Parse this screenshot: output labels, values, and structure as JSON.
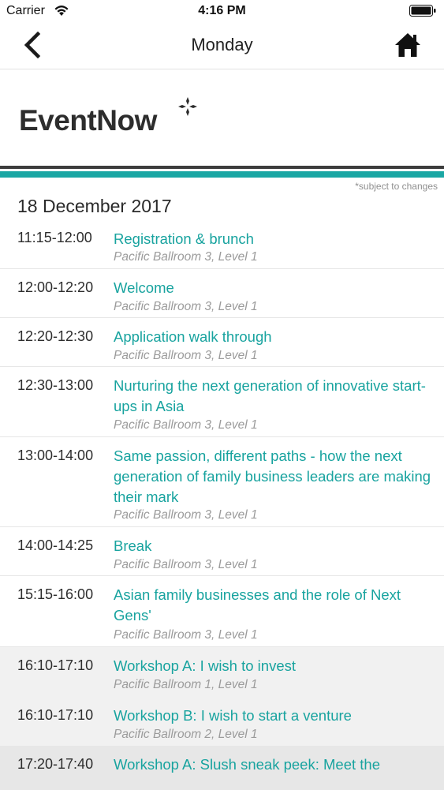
{
  "status": {
    "carrier": "Carrier",
    "time": "4:16 PM"
  },
  "nav": {
    "title": "Monday",
    "back_icon": "chevron-left-icon",
    "home_icon": "home-icon"
  },
  "brand": {
    "logo_text": "EventNow"
  },
  "note": "*subject to changes",
  "date": "18 December 2017",
  "colors": {
    "accent": "#1aa7a4",
    "dark_rule": "#3c3c3c",
    "gray_row": "#f1f1f1"
  },
  "sessions": [
    {
      "time": "11:15-12:00",
      "title": "Registration & brunch",
      "location": "Pacific Ballroom 3, Level 1"
    },
    {
      "time": "12:00-12:20",
      "title": "Welcome",
      "location": "Pacific Ballroom 3, Level 1"
    },
    {
      "time": "12:20-12:30",
      "title": "Application walk through",
      "location": "Pacific Ballroom 3, Level 1"
    },
    {
      "time": "12:30-13:00",
      "title": "Nurturing the next generation of innovative start-ups in Asia",
      "location": "Pacific Ballroom 3, Level 1"
    },
    {
      "time": "13:00-14:00",
      "title": "Same passion, different paths - how the next generation of family business leaders are making their mark",
      "location": "Pacific Ballroom 3, Level 1"
    },
    {
      "time": "14:00-14:25",
      "title": "Break",
      "location": "Pacific Ballroom 3, Level 1"
    },
    {
      "time": "15:15-16:00",
      "title": "Asian family businesses and the role of Next Gens'",
      "location": "Pacific Ballroom 3, Level 1"
    },
    {
      "time": "16:10-17:10",
      "title": "Workshop A: I wish to invest",
      "location": "Pacific Ballroom 1, Level 1"
    },
    {
      "time": "16:10-17:10",
      "title": "Workshop B: I wish to start a venture",
      "location": "Pacific Ballroom 2, Level 1"
    },
    {
      "time": "17:20-17:40",
      "title": "Workshop A: Slush sneak peek: Meet the",
      "location": ""
    }
  ]
}
